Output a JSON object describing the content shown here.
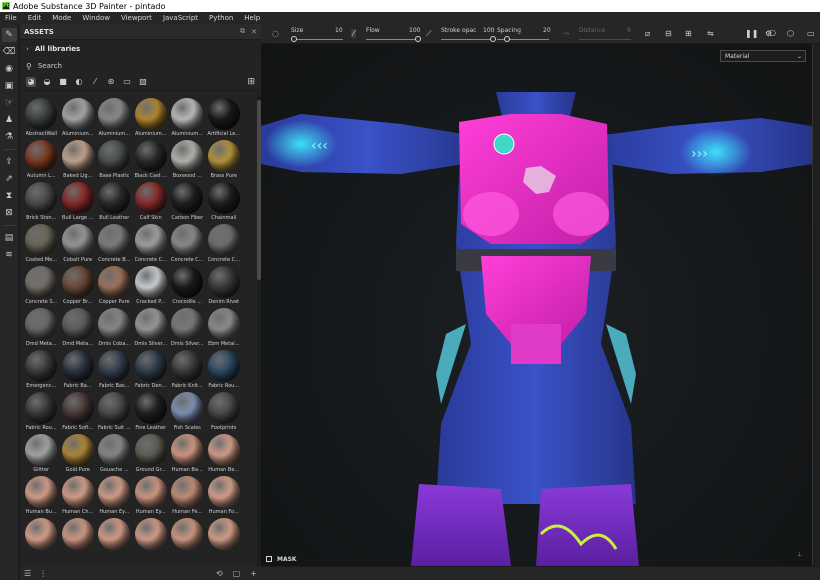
{
  "window": {
    "title": "Adobe Substance 3D Painter - pintado",
    "logo": "Pt"
  },
  "menu": [
    "File",
    "Edit",
    "Mode",
    "Window",
    "Viewport",
    "JavaScript",
    "Python",
    "Help"
  ],
  "tools": [
    "paint-brush-icon",
    "eraser-icon",
    "projection-icon",
    "geometry-mask-icon",
    "smudge-icon",
    "clone-icon",
    "material-picker-icon",
    "bake-icon",
    "export-icon",
    "layer-icon"
  ],
  "assets": {
    "title": "ASSETS",
    "library": "All libraries",
    "search_label": "Search",
    "items": [
      {
        "name": "AbstractWall",
        "color": "#3a3f3f"
      },
      {
        "name": "Aluminium...",
        "color": "#a9a9a9"
      },
      {
        "name": "Aluminium...",
        "color": "#8d8d8d"
      },
      {
        "name": "Aluminium...",
        "color": "#b48a2e"
      },
      {
        "name": "Aluminium...",
        "color": "#c0c0c0"
      },
      {
        "name": "Artificial Le...",
        "color": "#1a1a1a"
      },
      {
        "name": "Autumn L...",
        "color": "#7e3a22"
      },
      {
        "name": "Baked Lig...",
        "color": "#c7a890"
      },
      {
        "name": "Base Plastic",
        "color": "#4a4f4f"
      },
      {
        "name": "Black Cast ...",
        "color": "#2a2a2a"
      },
      {
        "name": "Boxwood ...",
        "color": "#b7b7b2"
      },
      {
        "name": "Brass Pure",
        "color": "#b9963e"
      },
      {
        "name": "Brick Ston...",
        "color": "#4b4b4b"
      },
      {
        "name": "Bull Large ...",
        "color": "#8b2a2a"
      },
      {
        "name": "Bull Leather",
        "color": "#2b2b2b"
      },
      {
        "name": "Calf Skin",
        "color": "#8a2b2b"
      },
      {
        "name": "Carbon Fiber",
        "color": "#202020"
      },
      {
        "name": "Chainmail",
        "color": "#1f1f1f"
      },
      {
        "name": "Coated Me...",
        "color": "#6b6658"
      },
      {
        "name": "Cobalt Pure",
        "color": "#9a9a9a"
      },
      {
        "name": "Concrete B...",
        "color": "#7f7f7f"
      },
      {
        "name": "Concrete C...",
        "color": "#a3a3a3"
      },
      {
        "name": "Concrete C...",
        "color": "#8c8c8c"
      },
      {
        "name": "Concrete C...",
        "color": "#6f6f6f"
      },
      {
        "name": "Concrete S...",
        "color": "#77706a"
      },
      {
        "name": "Copper Br...",
        "color": "#6b4a3a"
      },
      {
        "name": "Copper Pure",
        "color": "#a0735e"
      },
      {
        "name": "Cracked P...",
        "color": "#cfd3d6"
      },
      {
        "name": "Crocodile ...",
        "color": "#1a1a1a"
      },
      {
        "name": "Denim Rivet",
        "color": "#3a3a38"
      },
      {
        "name": "Dmd Meta...",
        "color": "#6a6a6a"
      },
      {
        "name": "Dmd Meta...",
        "color": "#5d5d5d"
      },
      {
        "name": "Dmls Coba...",
        "color": "#8a8a8a"
      },
      {
        "name": "Dmls Silver...",
        "color": "#9b9b9b"
      },
      {
        "name": "Dmls Silver...",
        "color": "#7b7b7b"
      },
      {
        "name": "Ebm Metal...",
        "color": "#8e8e8e"
      },
      {
        "name": "Emergenc...",
        "color": "#3b3b3b"
      },
      {
        "name": "Fabric Ba...",
        "color": "#2c3440"
      },
      {
        "name": "Fabric Bas...",
        "color": "#34414f"
      },
      {
        "name": "Fabric Den...",
        "color": "#303d4c"
      },
      {
        "name": "Fabric Knit...",
        "color": "#3a3a3a"
      },
      {
        "name": "Fabric Rou...",
        "color": "#2d4a66"
      },
      {
        "name": "Fabric Rou...",
        "color": "#3a3a3a"
      },
      {
        "name": "Fabric Soft...",
        "color": "#4a3a36"
      },
      {
        "name": "Fabric Suit ...",
        "color": "#4b4b4b"
      },
      {
        "name": "Fine Leather",
        "color": "#202020"
      },
      {
        "name": "Fish Scales",
        "color": "#7f93b8"
      },
      {
        "name": "Footprints",
        "color": "#4a4a4a"
      },
      {
        "name": "Glitter",
        "color": "#a8a8a8"
      },
      {
        "name": "Gold Pure",
        "color": "#b08a3a"
      },
      {
        "name": "Gouache ...",
        "color": "#8a8a8a"
      },
      {
        "name": "Ground Gr...",
        "color": "#5f5e55"
      },
      {
        "name": "Human Ba...",
        "color": "#d49a84"
      },
      {
        "name": "Human Be...",
        "color": "#d6a08c"
      },
      {
        "name": "Human Bu...",
        "color": "#d9a18a"
      },
      {
        "name": "Human Ch...",
        "color": "#d8a28c"
      },
      {
        "name": "Human Ey...",
        "color": "#d6a08a"
      },
      {
        "name": "Human Ey...",
        "color": "#d29a84"
      },
      {
        "name": "Human Fe...",
        "color": "#c79079"
      },
      {
        "name": "Human Fo...",
        "color": "#d7a38d"
      },
      {
        "name": "",
        "color": "#d9a28c"
      },
      {
        "name": "",
        "color": "#d49c86"
      },
      {
        "name": "",
        "color": "#d8a08a"
      },
      {
        "name": "",
        "color": "#d6a08a"
      },
      {
        "name": "",
        "color": "#d29b85"
      },
      {
        "name": "",
        "color": "#d7a28c"
      }
    ]
  },
  "brush": {
    "size_label": "Size",
    "size_value": "10",
    "size_fraction": 0.05,
    "flow_label": "Flow",
    "flow_value": "100",
    "flow_fraction": 1.0,
    "stroke_label": "Stroke opac",
    "stroke_value": "100",
    "stroke_fraction": 1.0,
    "spacing_label": "Spacing",
    "spacing_value": "20",
    "spacing_fraction": 0.2,
    "distance_label": "Distance",
    "distance_value": "8"
  },
  "viewport": {
    "material_mode": "Material",
    "mask_label": "MASK"
  }
}
